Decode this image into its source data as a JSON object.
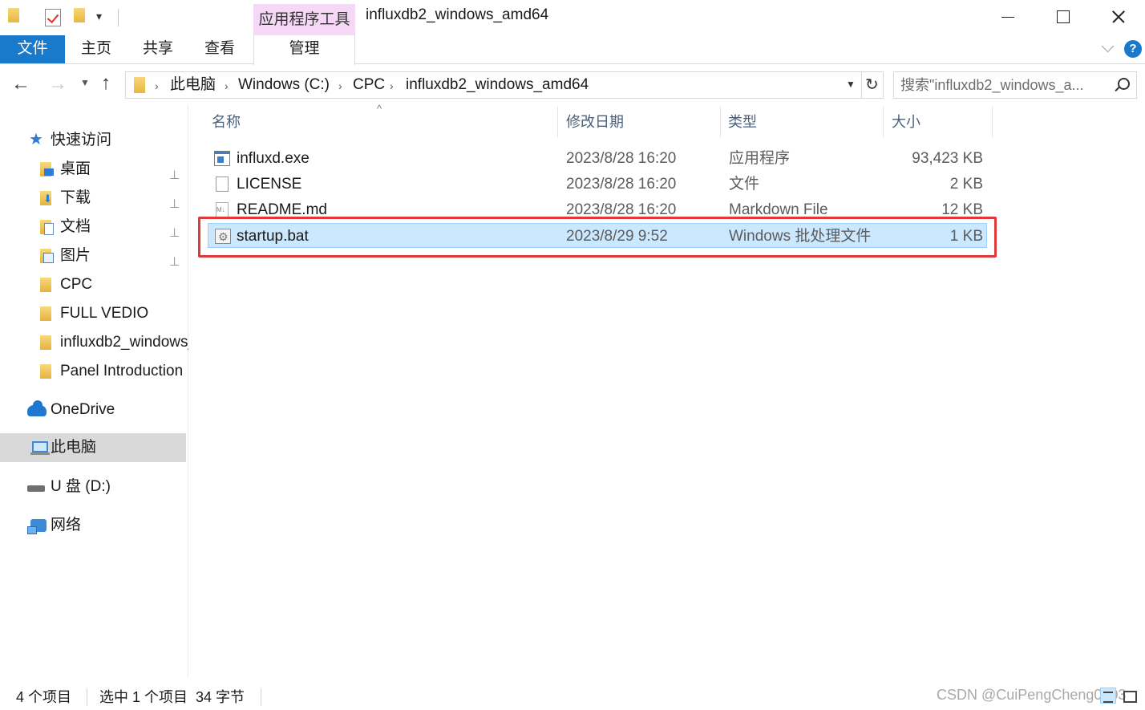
{
  "window": {
    "context_tab_header": "应用程序工具",
    "title": "influxdb2_windows_amd64"
  },
  "ribbon": {
    "tabs": [
      "文件",
      "主页",
      "共享",
      "查看",
      "管理"
    ],
    "help_label": "?"
  },
  "nav": {
    "back_glyph": "←",
    "forward_glyph": "→",
    "recent_glyph": "⌄",
    "up_glyph": "↑"
  },
  "address": {
    "crumbs": [
      "此电脑",
      "Windows (C:)",
      "CPC",
      "influxdb2_windows_amd64"
    ],
    "separator": "›",
    "dropdown_glyph": "⌄",
    "refresh_glyph": "↻"
  },
  "search": {
    "placeholder": "搜索\"influxdb2_windows_a..."
  },
  "sidebar": {
    "quick_access": "快速访问",
    "pinned": [
      "桌面",
      "下载",
      "文档",
      "图片"
    ],
    "recent_folders": [
      "CPC",
      "FULL VEDIO",
      "influxdb2_windows_amd64",
      "Panel Introduction"
    ],
    "onedrive": "OneDrive",
    "this_pc": "此电脑",
    "usb": "U 盘 (D:)",
    "network": "网络",
    "pin_glyph": "📌"
  },
  "columns": {
    "name": "名称",
    "modified": "修改日期",
    "type": "类型",
    "size": "大小",
    "sort_glyph": "^"
  },
  "files": [
    {
      "name": "influxd.exe",
      "modified": "2023/8/28 16:20",
      "type": "应用程序",
      "size": "93,423 KB",
      "icon": "exe-icon"
    },
    {
      "name": "LICENSE",
      "modified": "2023/8/28 16:20",
      "type": "文件",
      "size": "2 KB",
      "icon": "document-icon"
    },
    {
      "name": "README.md",
      "modified": "2023/8/28 16:20",
      "type": "Markdown File",
      "size": "12 KB",
      "icon": "markdown-icon"
    },
    {
      "name": "startup.bat",
      "modified": "2023/8/29 9:52",
      "type": "Windows 批处理文件",
      "size": "1 KB",
      "icon": "batch-file-icon",
      "selected": true
    }
  ],
  "status": {
    "item_count": "4 个项目",
    "selection": "选中 1 个项目  34 字节"
  },
  "watermark": "CSDN @CuiPengCheng0703",
  "colors": {
    "file_tab": "#1979ca",
    "context_tab": "#f4d8f5",
    "selection": "#cce8ff",
    "highlight_box": "#e0393a"
  }
}
